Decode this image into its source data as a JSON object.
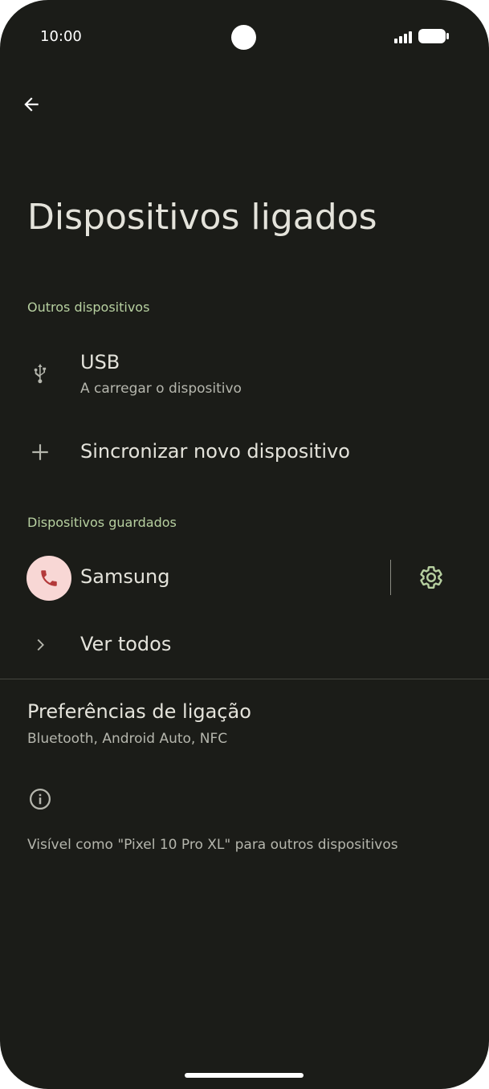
{
  "status_bar": {
    "time": "10:00",
    "icons": [
      "signal-icon",
      "battery-icon"
    ]
  },
  "header": {
    "back_icon": "arrow-back-icon",
    "title": "Dispositivos ligados"
  },
  "sections": {
    "other_devices": {
      "header": "Outros dispositivos",
      "usb": {
        "icon": "usb-icon",
        "title": "USB",
        "subtitle": "A carregar o dispositivo"
      },
      "pair_new": {
        "icon": "plus-icon",
        "title": "Sincronizar novo dispositivo"
      }
    },
    "saved_devices": {
      "header": "Dispositivos guardados",
      "device": {
        "icon": "phone-icon",
        "name": "Samsung",
        "settings_icon": "gear-icon"
      },
      "see_all": {
        "icon": "chevron-right-icon",
        "title": "Ver todos"
      }
    }
  },
  "connection_prefs": {
    "title": "Preferências de ligação",
    "subtitle": "Bluetooth, Android Auto, NFC"
  },
  "info": {
    "icon": "info-icon",
    "text": "Visível como \"Pixel 10 Pro XL\" para outros dispositivos"
  },
  "colors": {
    "background": "#1b1c18",
    "accent": "#b7d0a0",
    "avatar_bg": "#f8d7d5",
    "avatar_icon": "#b3393a"
  }
}
